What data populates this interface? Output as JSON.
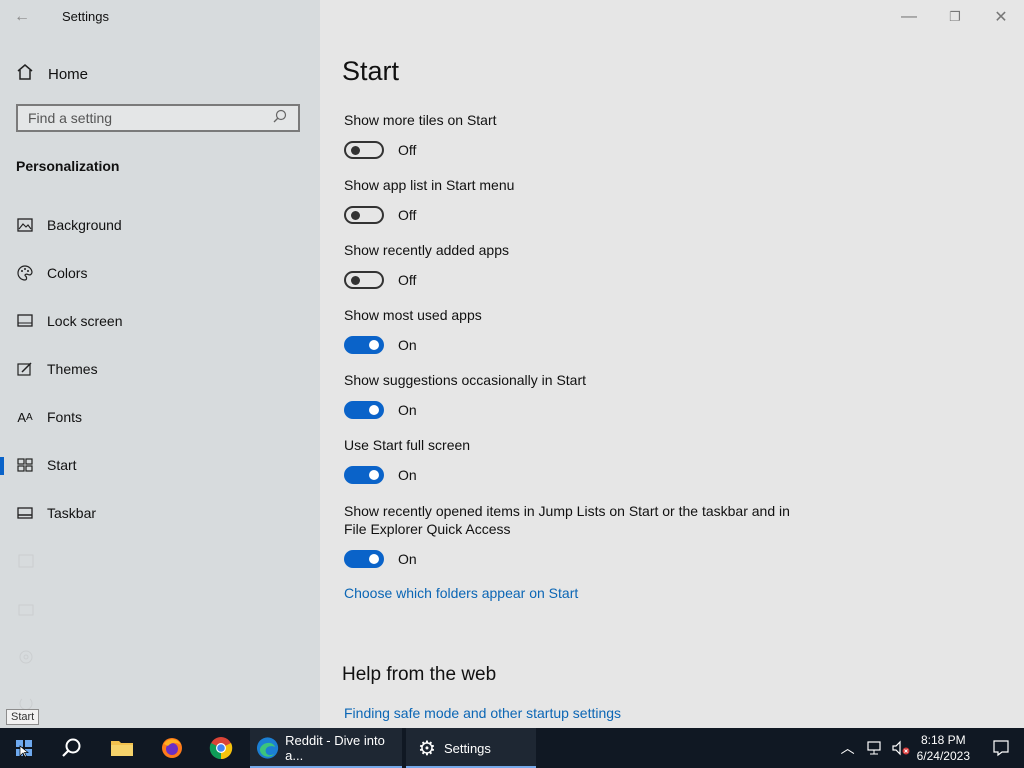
{
  "window": {
    "title": "Settings",
    "controls": {
      "minimize": "—",
      "restore": "❐",
      "close": "✕"
    }
  },
  "sidebar": {
    "home_label": "Home",
    "search_placeholder": "Find a setting",
    "section_title": "Personalization",
    "items": [
      {
        "label": "Background",
        "icon": "image-icon"
      },
      {
        "label": "Colors",
        "icon": "palette-icon"
      },
      {
        "label": "Lock screen",
        "icon": "lock-screen-icon"
      },
      {
        "label": "Themes",
        "icon": "themes-icon"
      },
      {
        "label": "Fonts",
        "icon": "fonts-icon"
      },
      {
        "label": "Start",
        "icon": "start-layout-icon",
        "active": true
      },
      {
        "label": "Taskbar",
        "icon": "taskbar-icon"
      }
    ]
  },
  "main": {
    "title": "Start",
    "settings": [
      {
        "label": "Show more tiles on Start",
        "state": "Off"
      },
      {
        "label": "Show app list in Start menu",
        "state": "Off"
      },
      {
        "label": "Show recently added apps",
        "state": "Off"
      },
      {
        "label": "Show most used apps",
        "state": "On"
      },
      {
        "label": "Show suggestions occasionally in Start",
        "state": "On"
      },
      {
        "label": "Use Start full screen",
        "state": "On"
      },
      {
        "label": "Show recently opened items in Jump Lists on Start or the taskbar and in File Explorer Quick Access",
        "state": "On"
      }
    ],
    "folders_link": "Choose which folders appear on Start",
    "help_title": "Help from the web",
    "help_link": "Finding safe mode and other startup settings"
  },
  "tooltip": "Start",
  "taskbar": {
    "edge_label": "Reddit - Dive into a...",
    "settings_label": "Settings",
    "time": "8:18 PM",
    "date": "6/24/2023"
  },
  "colors": {
    "accent": "#0a63c9",
    "link": "#0b66b5",
    "taskbar": "#101823"
  }
}
